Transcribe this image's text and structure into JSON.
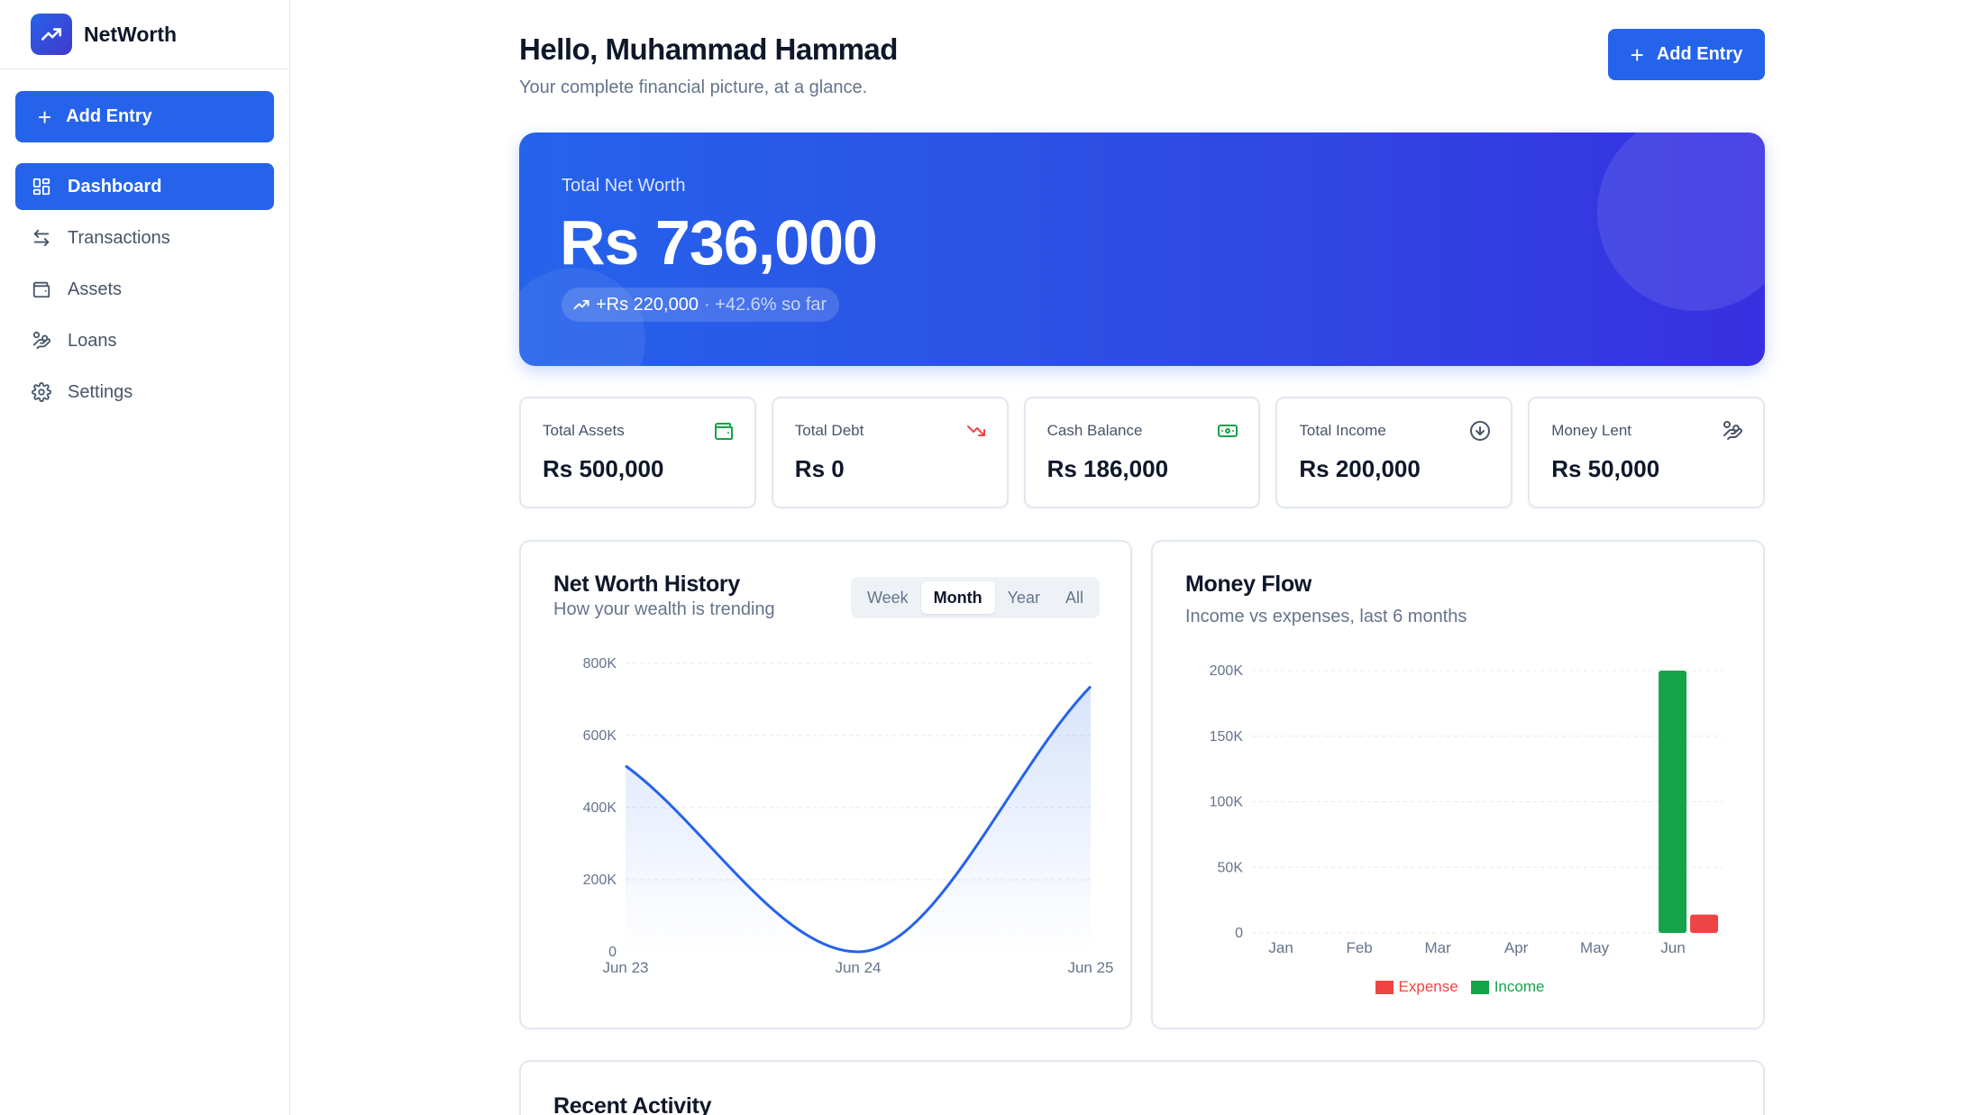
{
  "app": {
    "name": "NetWorth",
    "logo_icon": "trending-up-icon"
  },
  "sidebar": {
    "add_label": "Add Entry",
    "items": [
      {
        "label": "Dashboard",
        "icon": "dashboard-icon",
        "active": true
      },
      {
        "label": "Transactions",
        "icon": "arrows-exchange-icon",
        "active": false
      },
      {
        "label": "Assets",
        "icon": "wallet-icon",
        "active": false
      },
      {
        "label": "Loans",
        "icon": "hand-coins-icon",
        "active": false
      },
      {
        "label": "Settings",
        "icon": "gear-icon",
        "active": false
      }
    ]
  },
  "header": {
    "greeting": "Hello, Muhammad Hammad",
    "subtitle": "Your complete financial picture, at a glance.",
    "add_label": "Add Entry"
  },
  "hero": {
    "label": "Total Net Worth",
    "value": "Rs 736,000",
    "change": "+Rs 220,000",
    "change_pct": "· +42.6% so far"
  },
  "stats": [
    {
      "label": "Total Assets",
      "value": "Rs 500,000",
      "icon": "wallet-icon",
      "color": "#16a34a"
    },
    {
      "label": "Total Debt",
      "value": "Rs 0",
      "icon": "trending-down-icon",
      "color": "#ef4444"
    },
    {
      "label": "Cash Balance",
      "value": "Rs 186,000",
      "icon": "banknote-icon",
      "color": "#16a34a"
    },
    {
      "label": "Total Income",
      "value": "Rs 200,000",
      "icon": "arrow-down-circle-icon",
      "color": "#475569"
    },
    {
      "label": "Money Lent",
      "value": "Rs 50,000",
      "icon": "hand-coins-icon",
      "color": "#475569"
    }
  ],
  "net_worth_card": {
    "title": "Net Worth History",
    "subtitle": "How your wealth is trending",
    "ranges": [
      "Week",
      "Month",
      "Year",
      "All"
    ],
    "active_range": "Month"
  },
  "money_flow_card": {
    "title": "Money Flow",
    "subtitle": "Income vs expenses, last 6 months",
    "legend": [
      {
        "label": "Expense",
        "color": "#ef4444"
      },
      {
        "label": "Income",
        "color": "#16a34a"
      }
    ]
  },
  "recent_activity": {
    "title": "Recent Activity"
  },
  "colors": {
    "accent": "#2563eb",
    "income": "#16a34a",
    "expense": "#ef4444"
  },
  "chart_data": [
    {
      "type": "area",
      "x_ticks": [
        "Jun 23",
        "Jun 24",
        "Jun 25"
      ],
      "y_ticks": [
        "0",
        "200K",
        "400K",
        "600K",
        "800K"
      ],
      "ylim": [
        0,
        800000
      ],
      "grid": true,
      "series": [
        {
          "x": [
            "Jun 23",
            "Jun 24",
            "Jun 25"
          ],
          "values": [
            516000,
            0,
            736000
          ]
        }
      ]
    },
    {
      "type": "bar",
      "categories": [
        "Jan",
        "Feb",
        "Mar",
        "Apr",
        "May",
        "Jun"
      ],
      "y_ticks": [
        "0",
        "50K",
        "100K",
        "150K",
        "200K"
      ],
      "ylim": [
        0,
        200000
      ],
      "grid": true,
      "legend_position": "bottom",
      "series": [
        {
          "name": "Income",
          "values": [
            0,
            0,
            0,
            0,
            0,
            200000
          ]
        },
        {
          "name": "Expense",
          "values": [
            0,
            0,
            0,
            0,
            0,
            14000
          ]
        }
      ]
    }
  ]
}
